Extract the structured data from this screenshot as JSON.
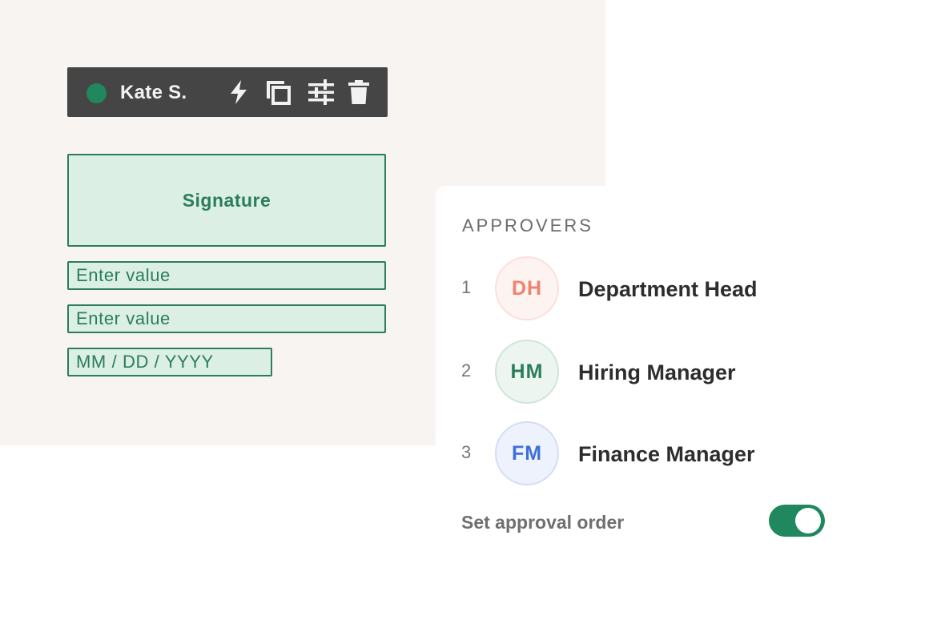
{
  "toolbar": {
    "user_name": "Kate S.",
    "status_color": "#21875e",
    "icons": [
      "lightning-icon",
      "duplicate-icon",
      "settings-sliders-icon",
      "trash-icon"
    ]
  },
  "form": {
    "signature_label": "Signature",
    "fields": [
      {
        "placeholder": "Enter value"
      },
      {
        "placeholder": "Enter value"
      },
      {
        "placeholder": "MM / DD / YYYY"
      }
    ],
    "accent_color": "#2b7d5c",
    "field_fill": "#dbefe4"
  },
  "approvers": {
    "heading": "APPROVERS",
    "items": [
      {
        "number": "1",
        "initials": "DH",
        "name": "Department Head",
        "color": "#f0826b",
        "bg": "#fdf3f1",
        "border": "#fbe0da"
      },
      {
        "number": "2",
        "initials": "HM",
        "name": "Hiring Manager",
        "color": "#2b7d5c",
        "bg": "#edf5f1",
        "border": "#cfe5d9"
      },
      {
        "number": "3",
        "initials": "FM",
        "name": "Finance Manager",
        "color": "#3f6fd6",
        "bg": "#eef2fd",
        "border": "#d3ddf6"
      }
    ],
    "order_label": "Set approval order",
    "order_enabled": true,
    "toggle_color": "#21875e"
  }
}
